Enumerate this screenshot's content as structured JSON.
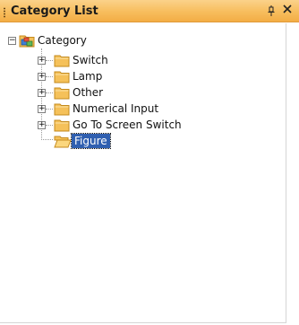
{
  "panel": {
    "title": "Category List",
    "pin_glyph": "ㅁ",
    "close_glyph": "×"
  },
  "tree": {
    "root": {
      "label": "Category",
      "expanded": true,
      "icon": "category-root-icon"
    },
    "children": [
      {
        "label": "Switch",
        "expanded": false,
        "icon": "folder-icon"
      },
      {
        "label": "Lamp",
        "expanded": false,
        "icon": "folder-icon"
      },
      {
        "label": "Other",
        "expanded": false,
        "icon": "folder-icon"
      },
      {
        "label": "Numerical Input",
        "expanded": false,
        "icon": "folder-icon"
      },
      {
        "label": "Go To Screen Switch",
        "expanded": false,
        "icon": "folder-icon"
      },
      {
        "label": "Figure",
        "selected": true,
        "icon": "open-folder-icon"
      }
    ]
  },
  "colors": {
    "title_bar": "#f7bd5d",
    "folder": "#f5c15a",
    "selection": "#2f5fb0"
  }
}
